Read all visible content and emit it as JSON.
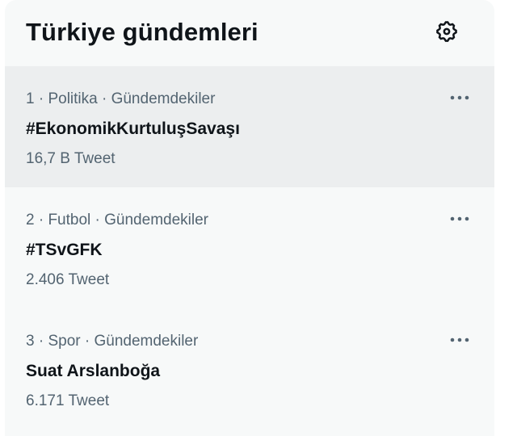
{
  "panel": {
    "title": "Türkiye gündemleri",
    "settings_icon": "gear-icon"
  },
  "trends": [
    {
      "meta": "1 · Politika · Gündemdekiler",
      "name": "#EkonomikKurtuluşSavaşı",
      "count": "16,7 B Tweet",
      "more_icon": "more-horizontal-icon",
      "highlighted": true
    },
    {
      "meta": "2 · Futbol · Gündemdekiler",
      "name": "#TSvGFK",
      "count": "2.406 Tweet",
      "more_icon": "more-horizontal-icon",
      "highlighted": false
    },
    {
      "meta": "3 · Spor · Gündemdekiler",
      "name": "Suat Arslanboğa",
      "count": "6.171 Tweet",
      "more_icon": "more-horizontal-icon",
      "highlighted": false
    }
  ],
  "colors": {
    "panel_bg": "#f7f9f9",
    "hover_bg": "#eceeef",
    "primary_text": "#0f1419",
    "secondary_text": "#536471"
  }
}
